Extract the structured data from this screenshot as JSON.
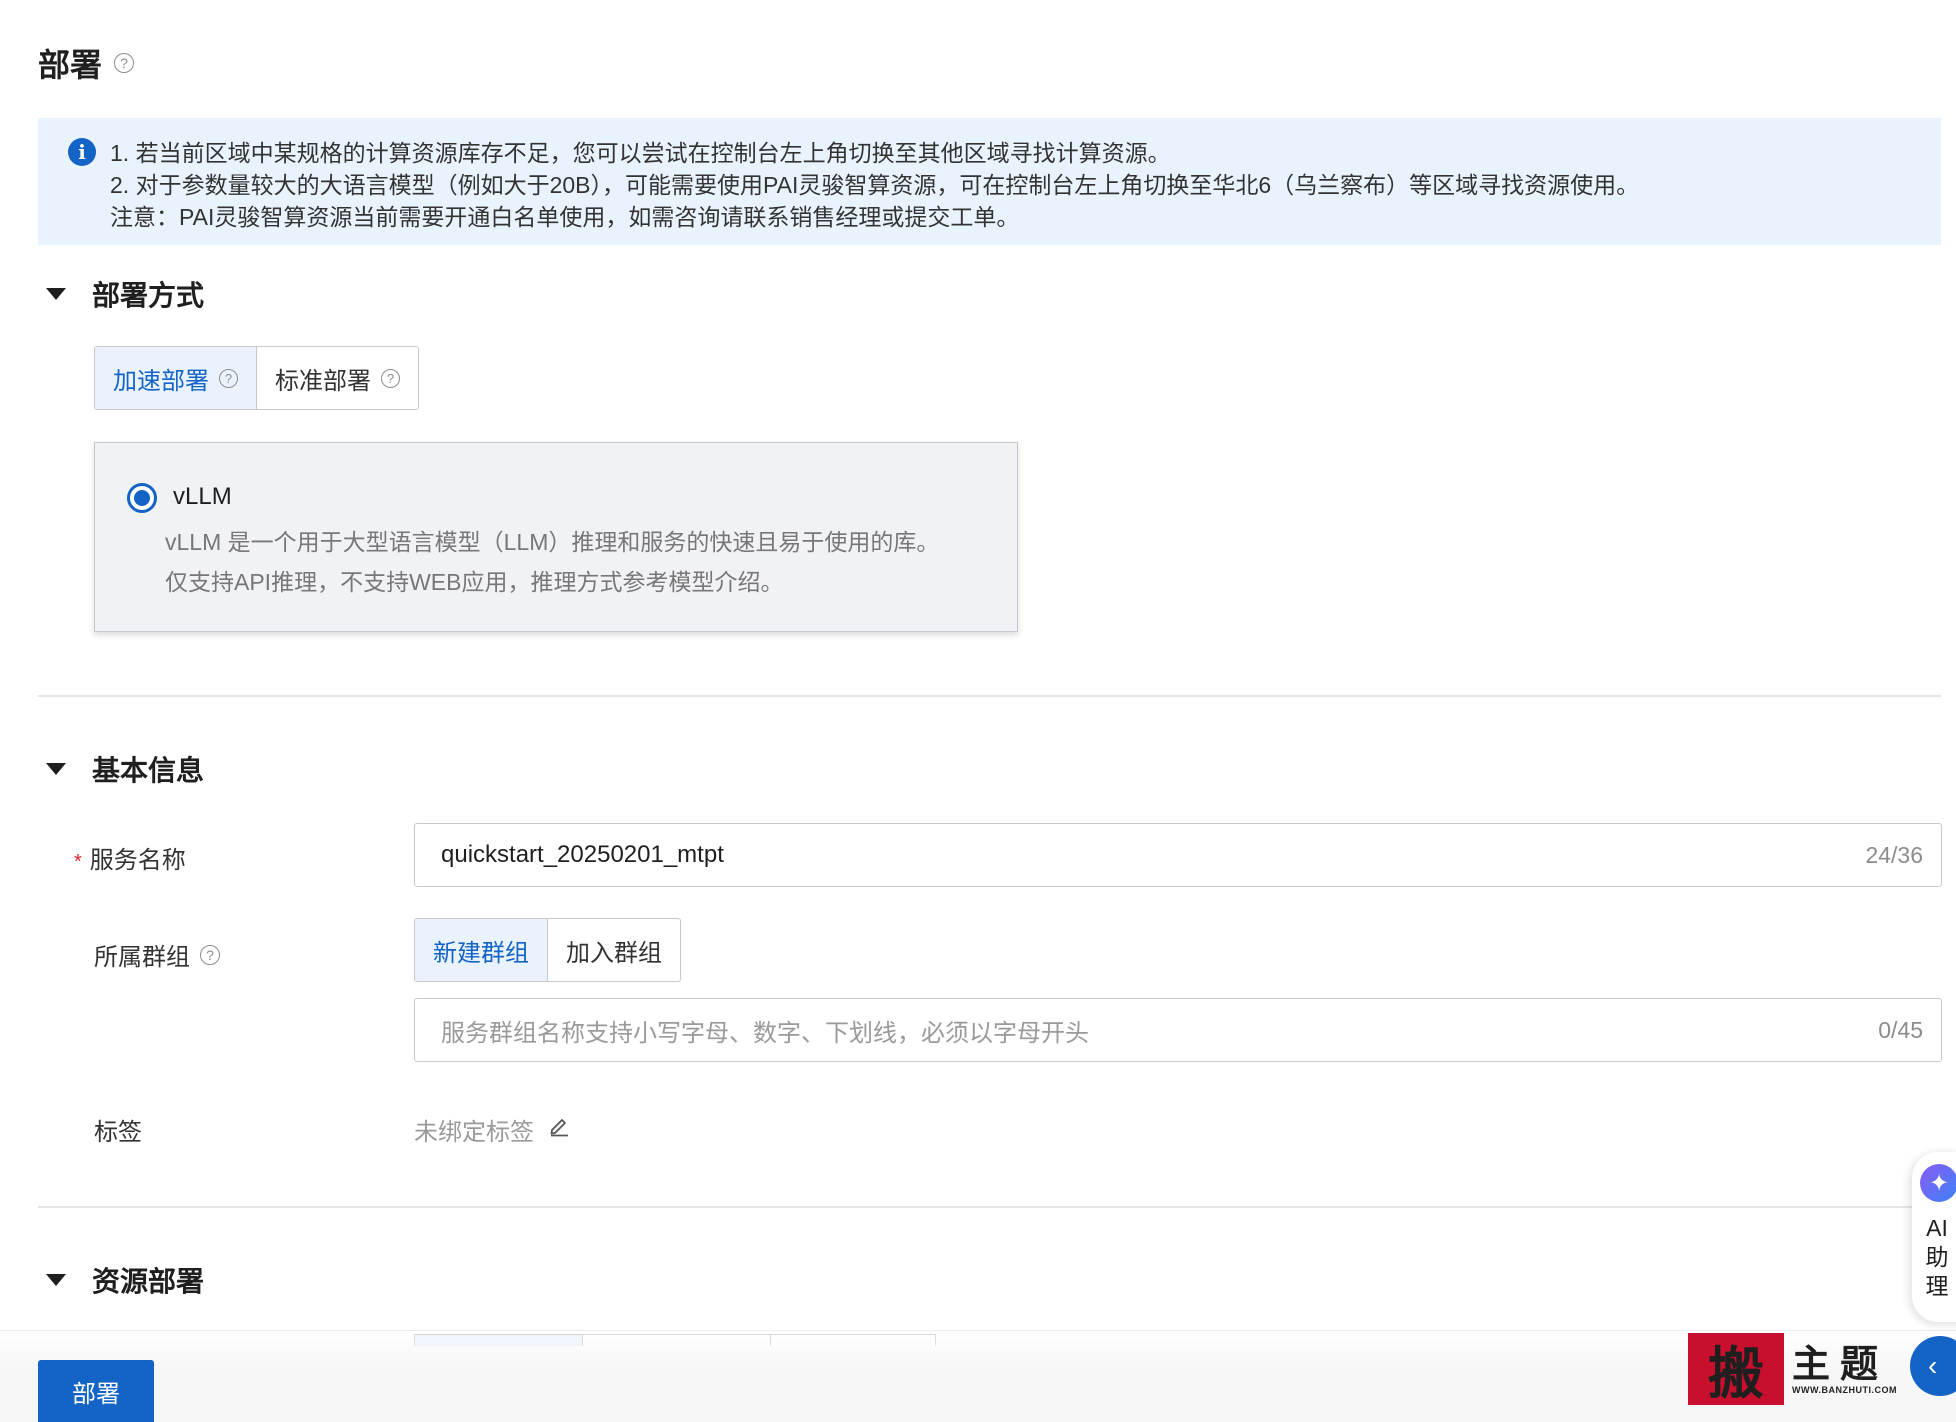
{
  "page": {
    "title": "部署",
    "help_icon": "question-circle-icon"
  },
  "notice": {
    "icon": "info-icon",
    "lines": [
      "1. 若当前区域中某规格的计算资源库存不足，您可以尝试在控制台左上角切换至其他区域寻找计算资源。",
      "2. 对于参数量较大的大语言模型（例如大于20B），可能需要使用PAI灵骏智算资源，可在控制台左上角切换至华北6（乌兰察布）等区域寻找资源使用。",
      "注意：PAI灵骏智算资源当前需要开通白名单使用，如需咨询请联系销售经理或提交工单。"
    ]
  },
  "deploy_method": {
    "heading": "部署方式",
    "options": [
      {
        "label": "加速部署",
        "selected": true
      },
      {
        "label": "标准部署",
        "selected": false
      }
    ],
    "engine": {
      "name": "vLLM",
      "selected": true,
      "desc_line1": "vLLM 是一个用于大型语言模型（LLM）推理和服务的快速且易于使用的库。",
      "desc_line2": "仅支持API推理，不支持WEB应用，推理方式参考模型介绍。"
    }
  },
  "basic_info": {
    "heading": "基本信息",
    "service_name": {
      "label": "服务名称",
      "required_mark": "*",
      "value": "quickstart_20250201_mtpt",
      "counter": "24/36"
    },
    "group": {
      "label": "所属群组",
      "options": [
        {
          "label": "新建群组",
          "selected": true
        },
        {
          "label": "加入群组",
          "selected": false
        }
      ],
      "placeholder": "服务群组名称支持小写字母、数字、下划线，必须以字母开头",
      "counter": "0/45"
    },
    "tags": {
      "label": "标签",
      "value": "未绑定标签",
      "edit_icon": "edit-pencil-icon"
    }
  },
  "resource": {
    "heading": "资源部署"
  },
  "footer": {
    "deploy_button": "部署"
  },
  "ai_assistant": {
    "label": "AI助理",
    "chars": [
      "AI",
      "助",
      "理"
    ],
    "icon": "ai-assistant-icon"
  },
  "collapse_button": {
    "icon": "chevron-left-icon"
  },
  "watermark": {
    "stamp_char": "搬",
    "text": "主题",
    "url": "WWW.BANZHUTI.COM"
  },
  "colors": {
    "primary": "#1364c6",
    "notice_bg": "#e8f3fd",
    "required": "#d9232d"
  }
}
